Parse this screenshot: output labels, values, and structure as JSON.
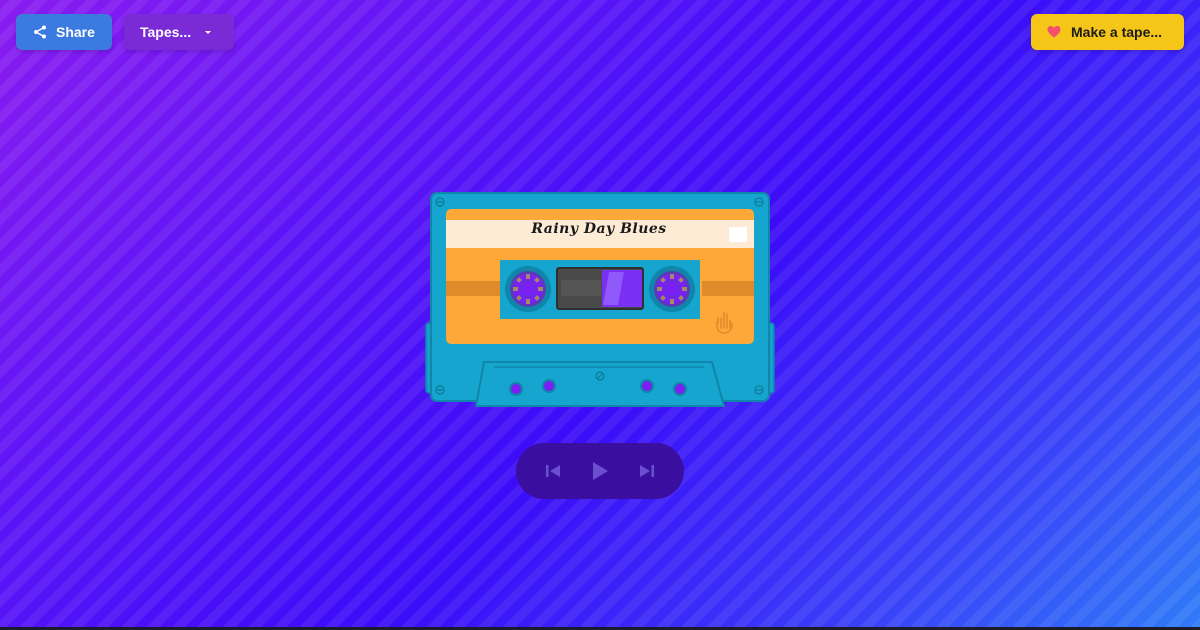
{
  "toolbar": {
    "share_label": "Share",
    "share_icon": "share-icon",
    "tapes_label": "Tapes...",
    "tapes_icon": "chevron-down-icon",
    "make_label": "Make a tape...",
    "make_icon": "heart-icon"
  },
  "cassette": {
    "title": "Rainy Day Blues",
    "emblem_icon": "rock-hand-icon"
  },
  "player": {
    "previous_icon": "skip-previous-icon",
    "play_icon": "play-icon",
    "next_icon": "skip-next-icon"
  },
  "colors": {
    "share_button": "#3b7bdf",
    "tapes_button": "#7a2bd6",
    "make_button": "#f5c518",
    "heart": "#f2506b",
    "cassette_shell": "#15a3cc",
    "cassette_label": "#ffa83a",
    "label_strip": "#fdebd6",
    "player_bg": "#3a0fa0"
  }
}
